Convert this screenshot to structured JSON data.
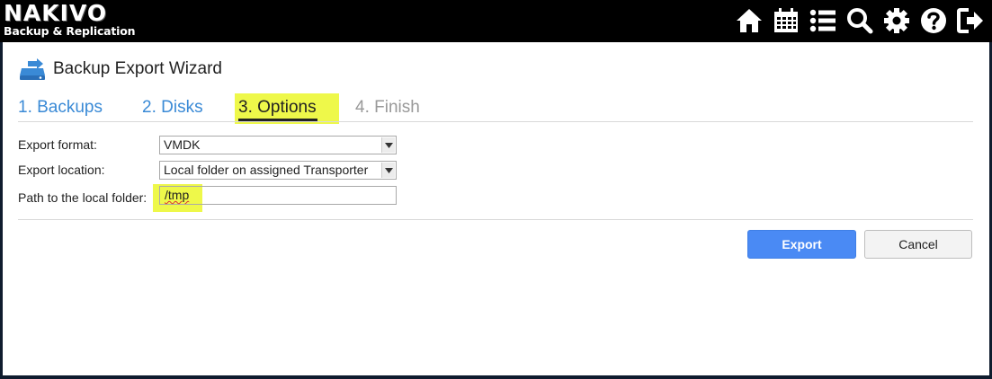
{
  "app": {
    "logo_main": "NAKIVO",
    "logo_sub": "Backup & Replication",
    "toolbar_icons": [
      "home-icon",
      "calendar-icon",
      "list-icon",
      "search-icon",
      "gear-icon",
      "help-icon",
      "logout-icon"
    ]
  },
  "wizard": {
    "title": "Backup Export Wizard",
    "steps": [
      {
        "label": "1. Backups",
        "state": "done"
      },
      {
        "label": "2. Disks",
        "state": "done"
      },
      {
        "label": "3. Options",
        "state": "active"
      },
      {
        "label": "4. Finish",
        "state": "todo"
      }
    ]
  },
  "form": {
    "export_format_label": "Export format:",
    "export_format_value": "VMDK",
    "export_location_label": "Export location:",
    "export_location_value": "Local folder on assigned Transporter",
    "path_label": "Path to the local folder:",
    "path_value": "/tmp"
  },
  "buttons": {
    "export": "Export",
    "cancel": "Cancel"
  },
  "colors": {
    "accent": "#4a8af4",
    "step_done": "#3a8ad6",
    "highlight": "#eef84a"
  }
}
